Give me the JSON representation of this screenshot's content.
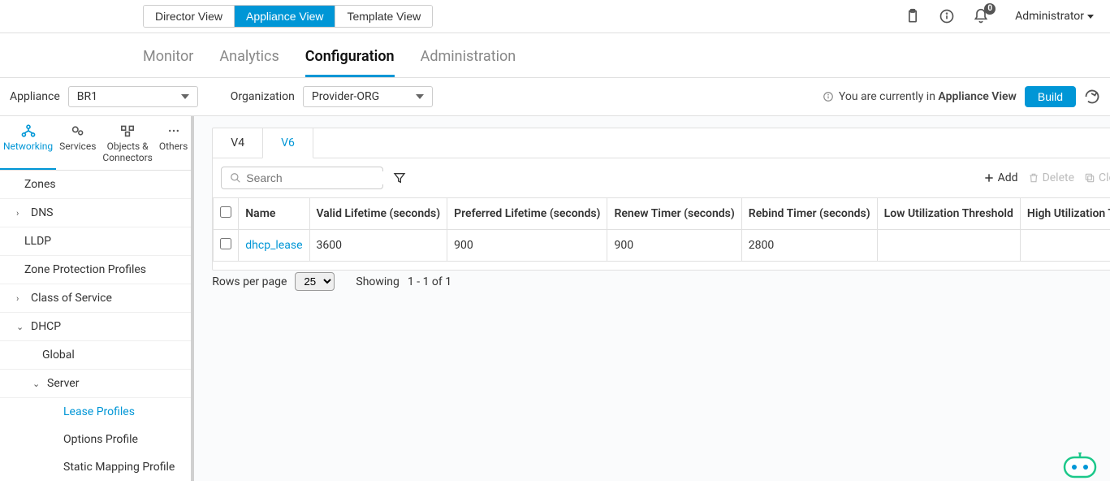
{
  "header": {
    "views": {
      "director": "Director View",
      "appliance": "Appliance View",
      "template": "Template View"
    },
    "notification_count": "0",
    "user_label": "Administrator"
  },
  "nav": {
    "monitor": "Monitor",
    "analytics": "Analytics",
    "configuration": "Configuration",
    "administration": "Administration"
  },
  "context": {
    "appliance_label": "Appliance",
    "appliance_value": "BR1",
    "org_label": "Organization",
    "org_value": "Provider-ORG",
    "info_prefix": "You are currently in ",
    "info_strong": "Appliance View",
    "build_label": "Build"
  },
  "sidebar_cats": {
    "networking": "Networking",
    "services": "Services",
    "objects": "Objects & Connectors",
    "others": "Others"
  },
  "tree": {
    "zones": "Zones",
    "dns": "DNS",
    "lldp": "LLDP",
    "zone_protection": "Zone Protection Profiles",
    "cos": "Class of Service",
    "dhcp": "DHCP",
    "global": "Global",
    "server": "Server",
    "lease_profiles": "Lease Profiles",
    "options_profile": "Options Profile",
    "static_mapping": "Static Mapping Profile"
  },
  "subtabs": {
    "v4": "V4",
    "v6": "V6"
  },
  "search": {
    "placeholder": "Search"
  },
  "actions": {
    "add": "Add",
    "delete": "Delete",
    "clone": "Clone"
  },
  "table": {
    "headers": {
      "name": "Name",
      "valid_lifetime": "Valid Lifetime (seconds)",
      "preferred_lifetime": "Preferred Lifetime (seconds)",
      "renew_timer": "Renew Timer (seconds)",
      "rebind_timer": "Rebind Timer (seconds)",
      "low_util": "Low Utilization Threshold",
      "high_util": "High Utilization Threshold"
    },
    "rows": [
      {
        "name": "dhcp_lease",
        "valid_lifetime": "3600",
        "preferred_lifetime": "900",
        "renew_timer": "900",
        "rebind_timer": "2800",
        "low_util": "",
        "high_util": ""
      }
    ]
  },
  "pager": {
    "rows_label": "Rows per page",
    "page_size": "25",
    "showing_label": "Showing",
    "showing_value": "1  -  1  of  1"
  }
}
